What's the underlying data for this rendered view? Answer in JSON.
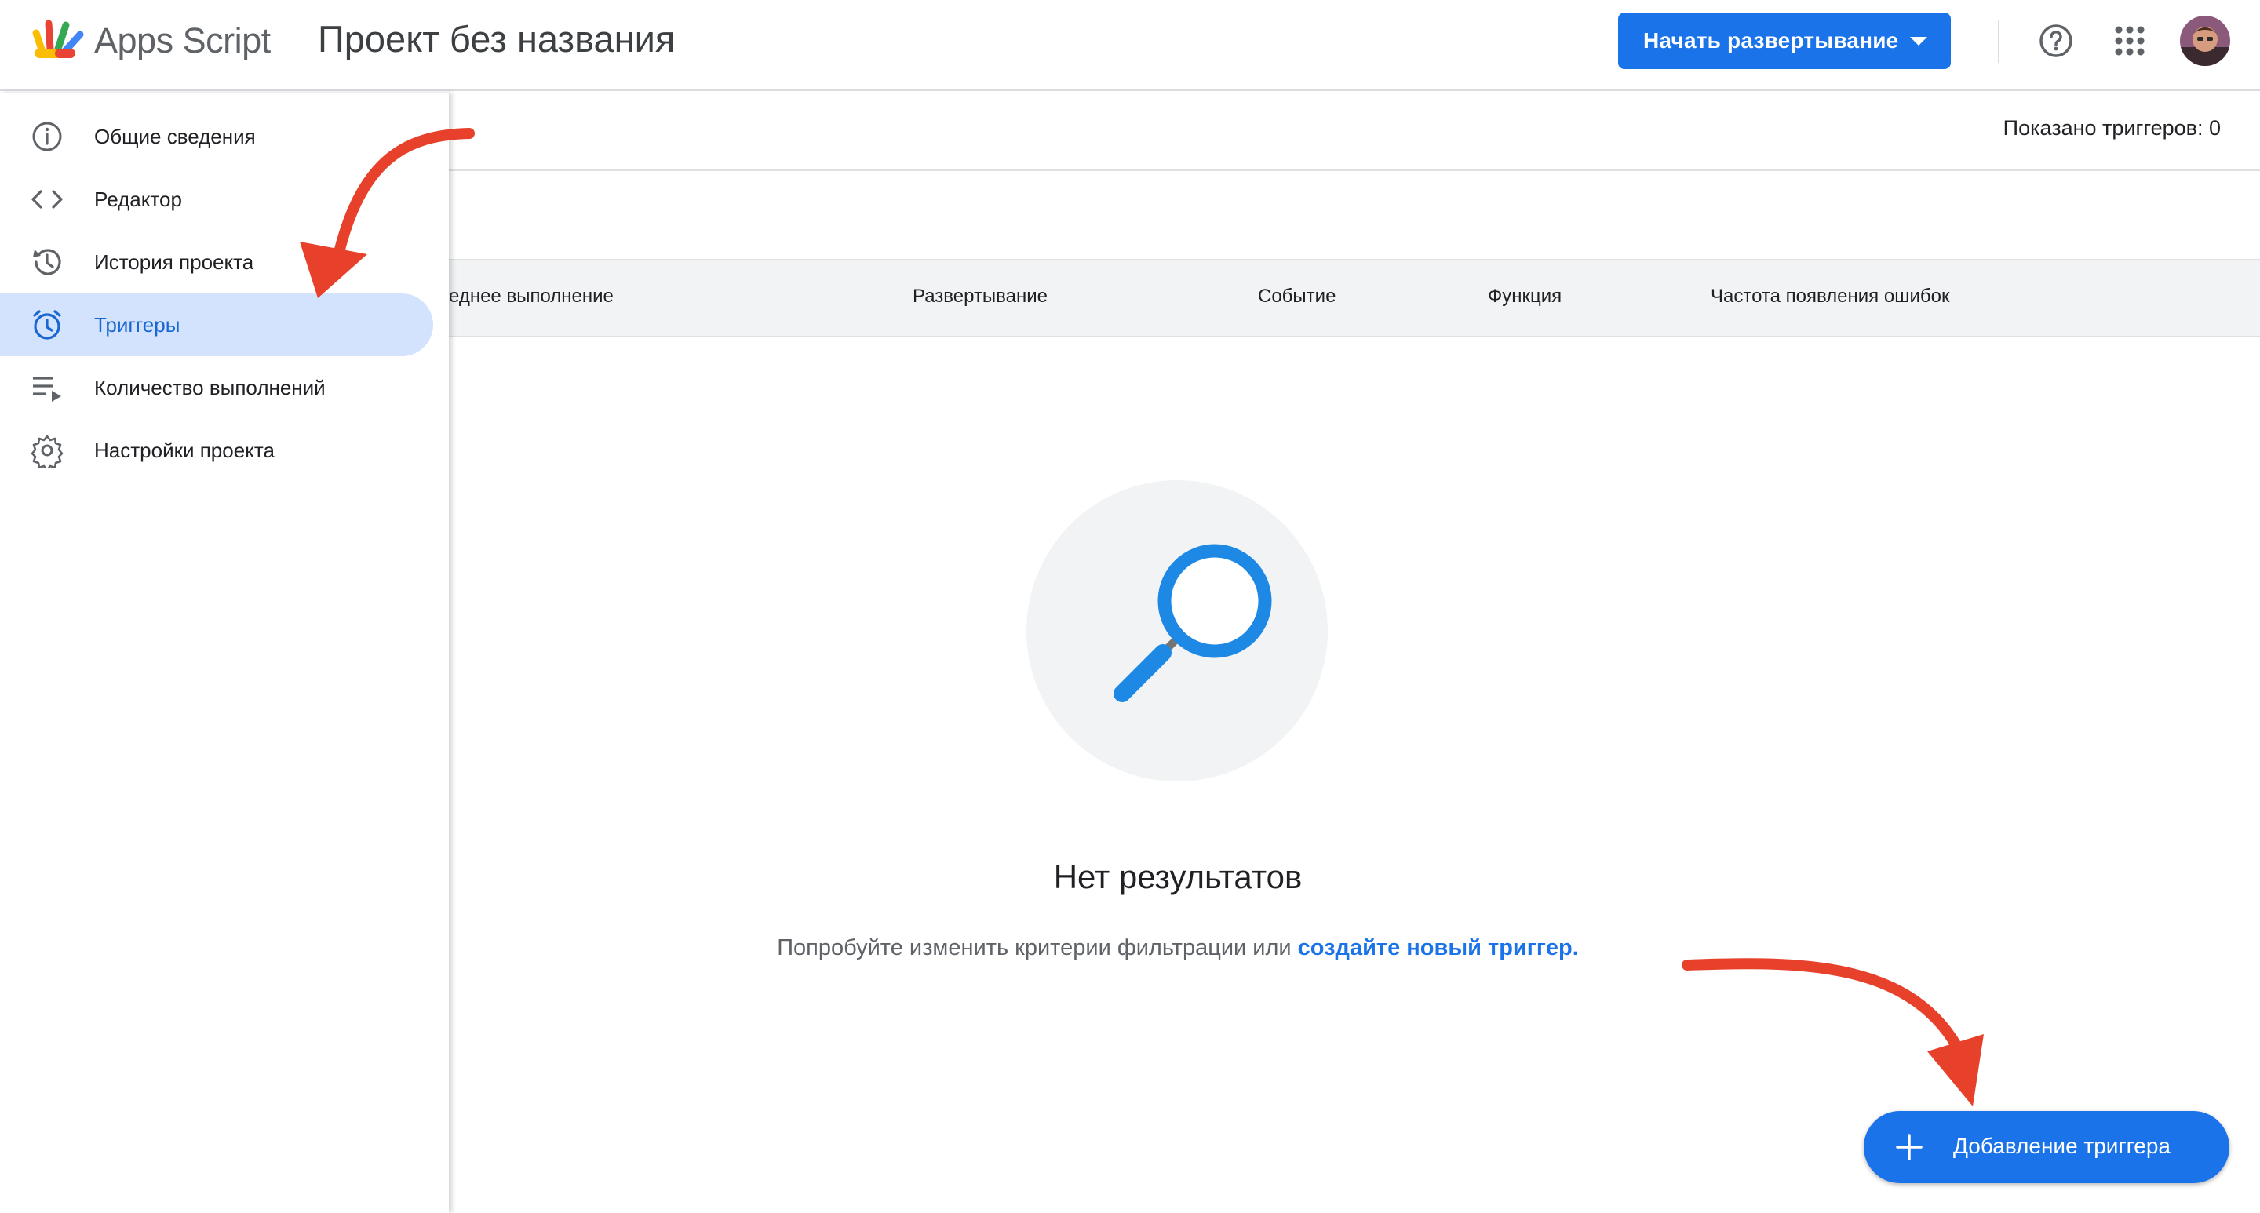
{
  "header": {
    "app_name": "Apps Script",
    "project_title": "Проект без названия",
    "deploy_label": "Начать развертывание",
    "avatar_alt": "Аккаунт"
  },
  "sidebar": {
    "items": [
      {
        "label": "Общие сведения",
        "icon": "info-icon",
        "active": false
      },
      {
        "label": "Редактор",
        "icon": "code-icon",
        "active": false
      },
      {
        "label": "История проекта",
        "icon": "history-icon",
        "active": false
      },
      {
        "label": "Триггеры",
        "icon": "alarm-icon",
        "active": true
      },
      {
        "label": "Количество выполнений",
        "icon": "executions-icon",
        "active": false
      },
      {
        "label": "Настройки проекта",
        "icon": "gear-icon",
        "active": false
      }
    ]
  },
  "main": {
    "shown_count": "Показано триггеров: 0",
    "columns": [
      "еднее выполнение",
      "Развертывание",
      "Событие",
      "Функция",
      "Частота появления ошибок"
    ],
    "empty_title": "Нет результатов",
    "empty_hint": "Попробуйте изменить критерии фильтрации или ",
    "empty_link": "создайте новый триггер.",
    "add_trigger_label": "Добавление триггера"
  },
  "colors": {
    "accent": "#1a73e8",
    "active_nav_bg": "#d3e3fd",
    "annotation_arrow": "#e8412b"
  }
}
